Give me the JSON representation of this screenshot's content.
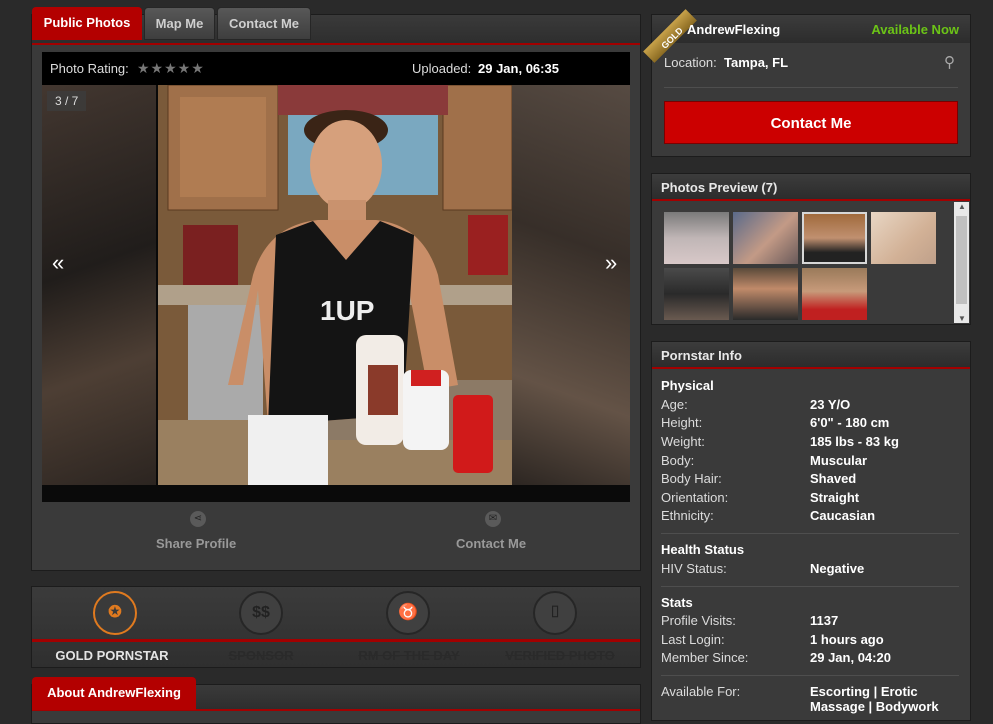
{
  "tabs": {
    "public_photos": "Public Photos",
    "map_me": "Map Me",
    "contact_me": "Contact Me"
  },
  "photo": {
    "rating_label": "Photo Rating:",
    "rating_stars": "★★★★★",
    "uploaded_label": "Uploaded:",
    "uploaded_value": "29 Jan, 06:35",
    "counter": "3 / 7",
    "prev": "«",
    "next": "»",
    "shirt_logo": "1UP",
    "share_label": "Share Profile",
    "contact_label": "Contact Me"
  },
  "badges": [
    {
      "label": "GOLD PORNSTAR",
      "icon": "medal-icon",
      "active": true
    },
    {
      "label": "SPONSOR",
      "icon": "dollar-icon",
      "active": false
    },
    {
      "label": "RM OF THE DAY",
      "icon": "devil-icon",
      "active": false
    },
    {
      "label": "VERIFIED PHOTO",
      "icon": "camera-icon",
      "active": false
    }
  ],
  "about_tab": "About AndrewFlexing",
  "profile": {
    "ribbon": "GOLD",
    "name": "AndrewFlexing",
    "availability": "Available Now",
    "location_label": "Location:",
    "location_value": "Tampa, FL",
    "contact_button": "Contact Me"
  },
  "photos_preview": {
    "title": "Photos Preview (7)",
    "count": 7
  },
  "pornstar_info": {
    "title": "Pornstar Info",
    "physical_heading": "Physical",
    "physical": [
      {
        "label": "Age:",
        "value": "23 Y/O"
      },
      {
        "label": "Height:",
        "value": "6'0\" - 180 cm"
      },
      {
        "label": "Weight:",
        "value": "185 lbs - 83 kg"
      },
      {
        "label": "Body:",
        "value": "Muscular"
      },
      {
        "label": "Body Hair:",
        "value": "Shaved"
      },
      {
        "label": "Orientation:",
        "value": "Straight"
      },
      {
        "label": "Ethnicity:",
        "value": "Caucasian"
      }
    ],
    "health_heading": "Health Status",
    "health": [
      {
        "label": "HIV Status:",
        "value": "Negative"
      }
    ],
    "stats_heading": "Stats",
    "stats": [
      {
        "label": "Profile Visits:",
        "value": "1137"
      },
      {
        "label": "Last Login:",
        "value": "1 hours ago"
      },
      {
        "label": "Member Since:",
        "value": "29 Jan, 04:20"
      }
    ],
    "available_label": "Available For:",
    "available_line1": "Escorting | Erotic",
    "available_line2": "Massage | Bodywork"
  },
  "colors": {
    "accent_red": "#b30000",
    "available_green": "#6cc417",
    "gold": "#c8a24a",
    "badge_active": "#e07a1f"
  }
}
